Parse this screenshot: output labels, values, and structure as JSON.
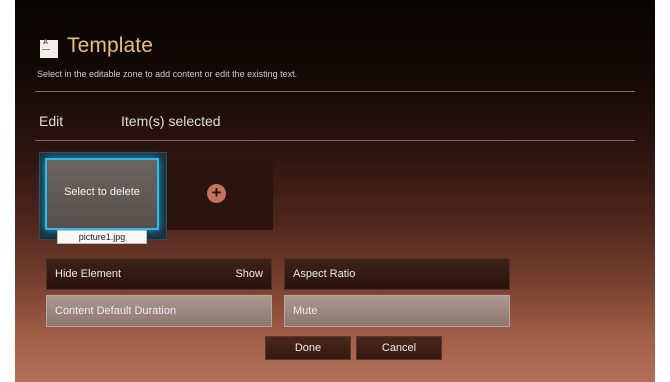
{
  "header": {
    "icon": "template-icon",
    "title": "Template",
    "subtitle": "Select in the editable zone to add content or edit the existing text."
  },
  "toolbar": {
    "edit_label": "Edit",
    "selected_label": "Item(s) selected"
  },
  "content_zone": {
    "selected_item": {
      "overlay_text": "Select to delete",
      "filename": "picture1.jpg"
    },
    "add_icon": "plus-circle-icon"
  },
  "options": {
    "hide_element": {
      "label": "Hide Element",
      "value": "Show"
    },
    "aspect_ratio": {
      "label": "Aspect Ratio"
    },
    "content_default_duration": {
      "label": "Content Default Duration"
    },
    "mute": {
      "label": "Mute"
    }
  },
  "actions": {
    "done_label": "Done",
    "cancel_label": "Cancel"
  },
  "colors": {
    "accent_title": "#e9c07b",
    "selection_border": "#2fb9ec"
  }
}
